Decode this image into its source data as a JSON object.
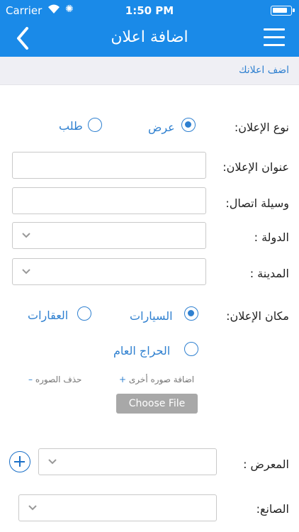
{
  "status_bar": {
    "carrier": "Carrier",
    "time": "1:50 PM",
    "battery_level": 0.85
  },
  "nav": {
    "title": "اضافة اعلان",
    "back_icon": "chevron-left-icon",
    "menu_icon": "hamburger-menu-icon"
  },
  "breadcrumb": "اضف اعلانك",
  "form": {
    "ad_type": {
      "label": "نوع الإعلان:",
      "options": [
        "عرض",
        "طلب"
      ],
      "selected": "عرض"
    },
    "ad_title": {
      "label": "عنوان الإعلان:",
      "value": ""
    },
    "contact": {
      "label": "وسيلة اتصال:",
      "value": ""
    },
    "country": {
      "label": "الدولة :",
      "value": ""
    },
    "city": {
      "label": "المدينة :",
      "value": ""
    },
    "ad_place": {
      "label": "مكان الإعلان:",
      "options": [
        "السيارات",
        "العقارات",
        "الحراج العام"
      ],
      "selected": "السيارات"
    },
    "image": {
      "add_more": "اضافة صوره أخرى",
      "delete": "حذف الصوره",
      "add_sign": "+",
      "delete_sign": "–",
      "choose_file": "Choose File"
    },
    "showroom": {
      "label": "المعرض :",
      "value": ""
    },
    "manufacturer": {
      "label": "الصانع:",
      "value": ""
    }
  },
  "colors": {
    "primary": "#1a8ae8",
    "accent": "#2f80d0",
    "background": "#ffffff",
    "breadcrumb_bg": "#efeff4"
  }
}
